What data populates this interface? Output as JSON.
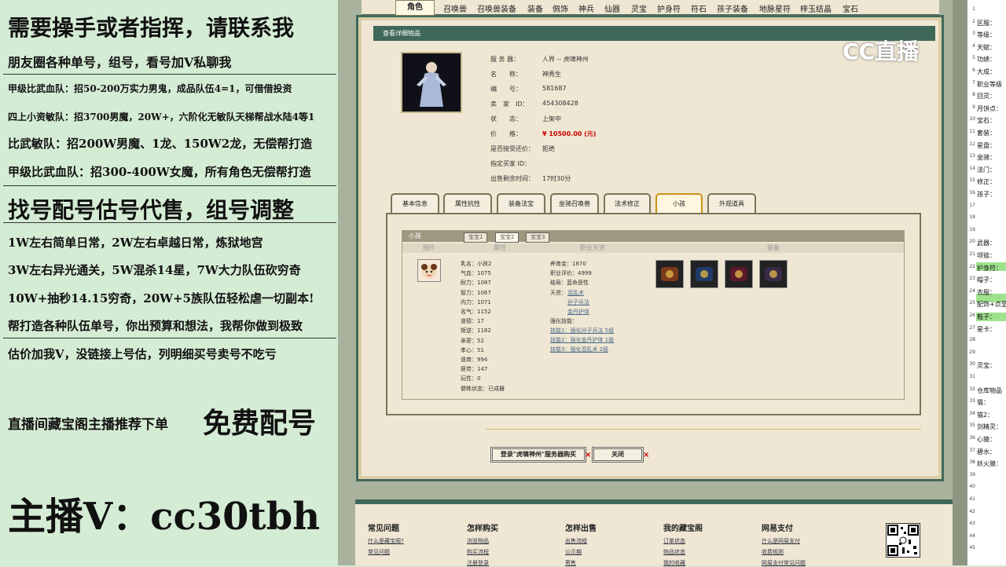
{
  "left": {
    "lines": [
      "需要操手或者指挥，请联系我",
      "朋友圈各种单号，组号，看号加V私聊我",
      "甲级比武血队：招50-200万实力男鬼，成品队伍4=1，可借借投资",
      "四上小资敏队：招3700男魔，20W+，六阶化无敏队天梯帮战水陆4等1",
      "比武敏队：招200W男魔、1龙、150W2龙，无偿帮打造",
      "甲级比武血队：招300-400W女魔，所有角色无偿帮打造",
      "找号配号估号代售，组号调整",
      "1W左右简单日常，2W左右卓越日常，炼狱地宫",
      "3W左右异光通关，5W混杀14星，7W大力队伍砍穷奇",
      "10W+抽秒14.15穷奇，20W+5族队伍轻松虐一切副本!",
      "帮打造各种队伍单号，你出预算和想法，我帮你做到极致",
      "估价加我V，没链接上号估，列明细买号卖号不吃亏",
      "直播间藏宝阁主播推荐下单",
      "免费配号",
      "主播V：cc30tbh"
    ]
  },
  "tabs": [
    "角色",
    "召唤兽",
    "召唤兽装备",
    "装备",
    "佩饰",
    "神兵",
    "仙器",
    "灵宝",
    "护身符",
    "符石",
    "孩子装备",
    "地脉星符",
    "梓玉结晶",
    "宝石"
  ],
  "header": {
    "title": "查看详细物品"
  },
  "info": {
    "labels": [
      "服 务 器：",
      "名　　称：",
      "编　　号：",
      "卖　家　ID：",
      "状　　态：",
      "价　　格：",
      "是否接受还价：",
      "指定买家 ID：",
      "出售剩余时间："
    ],
    "values": [
      "人界 -- 虎啸神州",
      "神秀生",
      "581687",
      "454308428",
      "上架中",
      "¥ 10500.00 (元)",
      "拒绝",
      "",
      "17时30分"
    ]
  },
  "bottom_tabs": [
    "基本信息",
    "属性抗性",
    "装备法宝",
    "坐骑召唤兽",
    "法术修正",
    "小孩",
    "外观道具"
  ],
  "child": {
    "header": "小孩",
    "sub_tabs": [
      "宝宝1",
      "宝宝2",
      "宝宝3"
    ],
    "columns": [
      "图片",
      "属性",
      "职业天资",
      "装备"
    ],
    "stats": [
      "乳名：小孩2",
      "气血：1075",
      "耐力：1087",
      "智力：1067",
      "内力：1071",
      "名气：1152",
      "道德：17",
      "叛逆：1182",
      "亲密：52",
      "孝心：51",
      "道商：994",
      "疲劳：147",
      "玩性：0",
      "健练状态：已成器"
    ],
    "info2": [
      "养育金：1870",
      "职业评价：4999",
      "结局：蓝命恶性",
      "天资："
    ],
    "talents": [
      "混乱术",
      "孙子兵法",
      "金丹护体"
    ],
    "skills_label": "强化技能：",
    "skills": [
      "技能1：强化孙子兵法 5级",
      "技能2：强化金丹护体 1级",
      "技能3：强化混乱术 2级"
    ]
  },
  "buttons": {
    "login": "登录\"虎啸神州\"服务器购买",
    "close": "关闭"
  },
  "footer": {
    "cols": [
      {
        "h": "常见问题",
        "l": [
          "什么是藏宝阁?",
          "常见问题"
        ]
      },
      {
        "h": "怎样购买",
        "l": [
          "浏览物品",
          "购买流程",
          "注册登录"
        ]
      },
      {
        "h": "怎样出售",
        "l": [
          "出售流程",
          "公示期",
          "寄售"
        ]
      },
      {
        "h": "我的藏宝阁",
        "l": [
          "订单状态",
          "物品状态",
          "我的收藏"
        ]
      },
      {
        "h": "网易支付",
        "l": [
          "什么是网易支付",
          "收费规则",
          "网易支付常见问题"
        ]
      }
    ]
  },
  "watermark": "CC直播",
  "right": {
    "rows": [
      [
        "1",
        ""
      ],
      [
        "2",
        "区服："
      ],
      [
        "3",
        "等级："
      ],
      [
        "4",
        "天赋："
      ],
      [
        "5",
        "功绩："
      ],
      [
        "6",
        "大成："
      ],
      [
        "7",
        "职业等级"
      ],
      [
        "8",
        "回灵："
      ],
      [
        "9",
        "月饼点："
      ],
      [
        "10",
        "宝石："
      ],
      [
        "11",
        "套装："
      ],
      [
        "12",
        "星盘："
      ],
      [
        "13",
        "坐骑："
      ],
      [
        "14",
        "法门："
      ],
      [
        "15",
        "修正："
      ],
      [
        "16",
        "孩子："
      ],
      [
        "17",
        ""
      ],
      [
        "18",
        ""
      ],
      [
        "19",
        ""
      ],
      [
        "20",
        "武器："
      ],
      [
        "21",
        "项链："
      ],
      [
        "22",
        "护身符："
      ],
      [
        "23",
        "帽子："
      ],
      [
        "24",
        "衣服："
      ],
      [
        "25",
        "配饰+点至"
      ],
      [
        "26",
        "鞋子："
      ],
      [
        "27",
        "星卡："
      ],
      [
        "28",
        ""
      ],
      [
        "29",
        ""
      ],
      [
        "30",
        "灵宝："
      ],
      [
        "31",
        ""
      ],
      [
        "32",
        "仓库物品"
      ],
      [
        "33",
        "猫："
      ],
      [
        "34",
        "猫2："
      ],
      [
        "35",
        "剑精灵："
      ],
      [
        "36",
        "心猿："
      ],
      [
        "37",
        "碧水："
      ],
      [
        "38",
        "妖火猿："
      ],
      [
        "39",
        ""
      ],
      [
        "40",
        ""
      ],
      [
        "41",
        ""
      ],
      [
        "42",
        ""
      ],
      [
        "43",
        ""
      ],
      [
        "44",
        ""
      ],
      [
        "45",
        ""
      ]
    ]
  }
}
